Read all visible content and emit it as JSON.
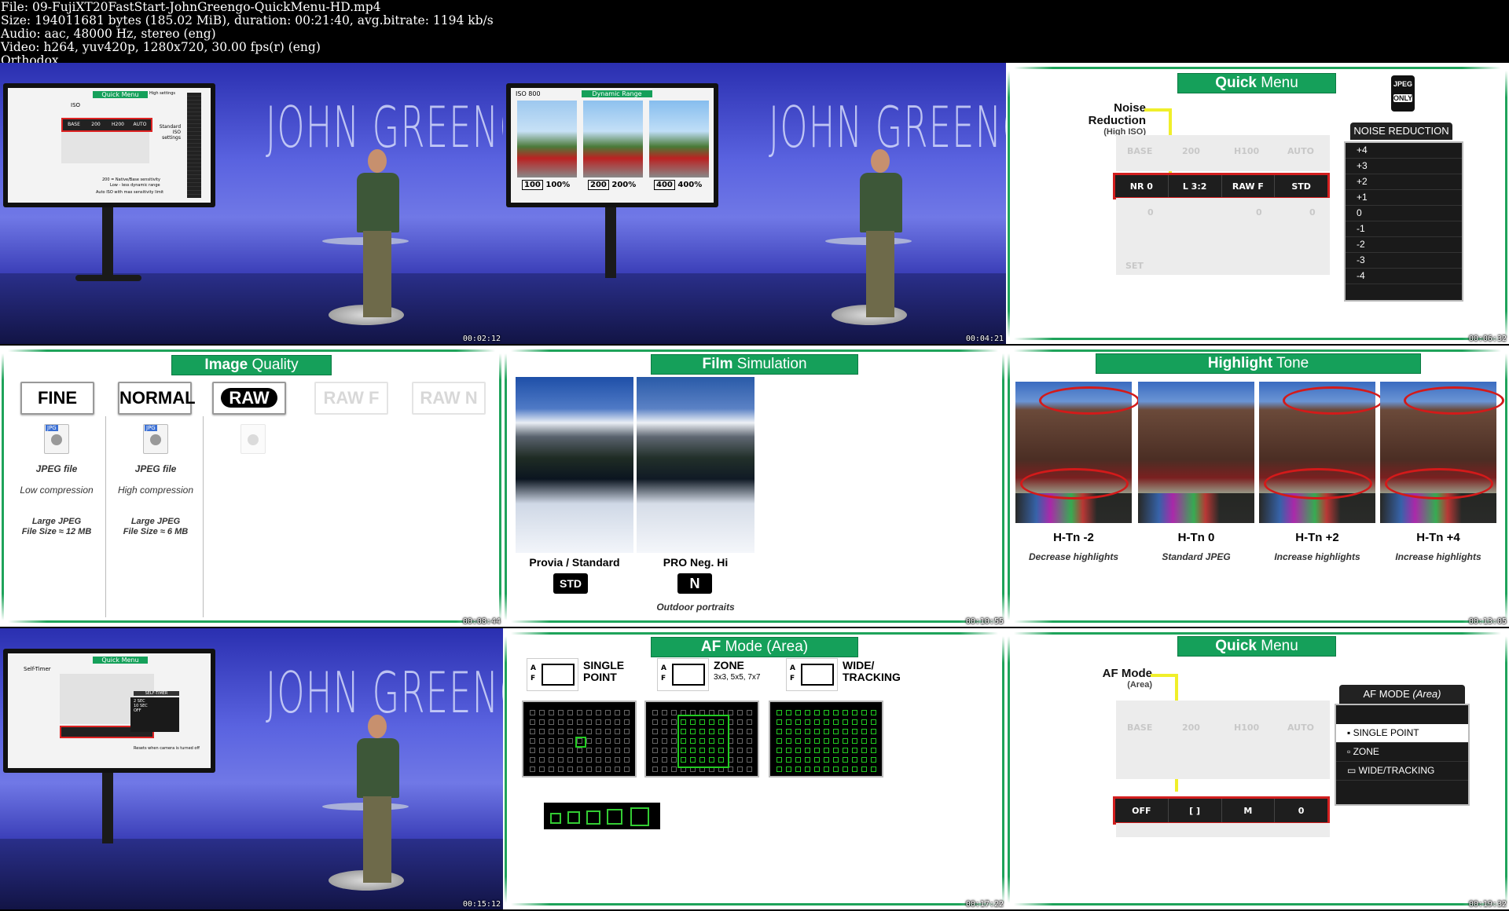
{
  "header": {
    "lines": [
      "File: 09-FujiXT20FastStart-JohnGreengo-QuickMenu-HD.mp4",
      "Size: 194011681 bytes (185.02 MiB), duration: 00:21:40, avg.bitrate: 1194 kb/s",
      "Audio: aac, 48000 Hz, stereo (eng)",
      "Video: h264, yuv420p, 1280x720, 30.00 fps(r) (eng)",
      "Orthodox"
    ]
  },
  "brand": "JOHN GREENGO",
  "tiles": [
    {
      "timestamp": "00:02:12",
      "screen": {
        "title": "Quick Menu",
        "iso": "ISO",
        "base": "BASE",
        "v200": "200",
        "h": "H200",
        "auto": "AUTO",
        "std": "Standard ISO settings",
        "hi": "High settings",
        "nat": "200 = Native/Base sensitivity",
        "low": "Low - less dynamic range",
        "autonote": "Auto ISO with max sensitivity limit"
      }
    },
    {
      "timestamp": "00:04:21",
      "screen": {
        "title": "Dynamic Range",
        "iso": "ISO 800",
        "c1a": "100",
        "c1b": "100%",
        "c2a": "200",
        "c2b": "200%",
        "c3a": "400",
        "c3b": "400%"
      }
    },
    {
      "timestamp": "00:06:32",
      "title_bold": "Quick",
      "title_rest": " Menu",
      "jpeg": "JPEG",
      "only": "ONLY",
      "label1": "Noise",
      "label2": "Reduction",
      "label3": "(High ISO)",
      "row": [
        "NR 0",
        "L 3:2",
        "RAW F",
        "STD"
      ],
      "ghost": [
        "BASE",
        "200",
        "H100",
        "AUTO"
      ],
      "ghost2": [
        "0",
        "0",
        "0"
      ],
      "set": "SET",
      "menu_title": "NOISE REDUCTION",
      "menu": [
        "+4",
        "+3",
        "+2",
        "+1",
        "0",
        "-1",
        "-2",
        "-3",
        "-4"
      ]
    },
    {
      "timestamp": "00:08:44",
      "title_bold": "Image",
      "title_rest": " Quality",
      "buttons": [
        "FINE",
        "NORMAL",
        "RAW",
        "RAW F",
        "RAW N"
      ],
      "jpg": "JPG",
      "fine_type": "JPEG file",
      "fine_comp": "Low compression",
      "fine_size1": "Large JPEG",
      "fine_size2": "File Size ≈ 12 MB",
      "norm_type": "JPEG file",
      "norm_comp": "High compression",
      "norm_size1": "Large JPEG",
      "norm_size2": "File Size ≈ 6 MB"
    },
    {
      "timestamp": "00:10:55",
      "title_bold": "Film",
      "title_rest": " Simulation",
      "left_label": "Provia / Standard",
      "left_icon": "STD",
      "right_label": "PRO Neg. Hi",
      "right_icon": "N",
      "right_sub": "Outdoor portraits"
    },
    {
      "timestamp": "00:13:05",
      "title_bold": "Highlight",
      "title_rest": " Tone",
      "items": [
        {
          "label": "H-Tn -2",
          "desc": "Decrease highlights"
        },
        {
          "label": "H-Tn 0",
          "desc": "Standard JPEG"
        },
        {
          "label": "H-Tn +2",
          "desc": "Increase highlights"
        },
        {
          "label": "H-Tn +4",
          "desc": "Increase highlights"
        }
      ]
    },
    {
      "timestamp": "00:15:12",
      "screen": {
        "title": "Quick Menu",
        "label": "Self-Timer",
        "menu": "SELF-TIMER",
        "o1": "2 SEC",
        "o2": "10 SEC",
        "o3": "OFF",
        "warn": "Resets when camera is turned off"
      }
    },
    {
      "timestamp": "00:17:22",
      "title_bold": "AF",
      "title_rest": " Mode (Area)",
      "af": "A F",
      "modes": [
        {
          "l1": "SINGLE",
          "l2": "POINT",
          "sub": ""
        },
        {
          "l1": "ZONE",
          "l2": "",
          "sub": "3x3, 5x5, 7x7"
        },
        {
          "l1": "WIDE/",
          "l2": "TRACKING",
          "sub": ""
        }
      ]
    },
    {
      "timestamp": "00:19:32",
      "title_bold": "Quick",
      "title_rest": " Menu",
      "label1": "AF Mode",
      "label2": "(Area)",
      "row": [
        "OFF",
        "[ ]",
        "M",
        "0"
      ],
      "ghost": [
        "BASE",
        "200",
        "H100",
        "AUTO"
      ],
      "menu_title_a": "AF MODE",
      "menu_title_b": " (Area)",
      "menu": [
        "SINGLE POINT",
        "ZONE",
        "WIDE/TRACKING"
      ]
    }
  ]
}
